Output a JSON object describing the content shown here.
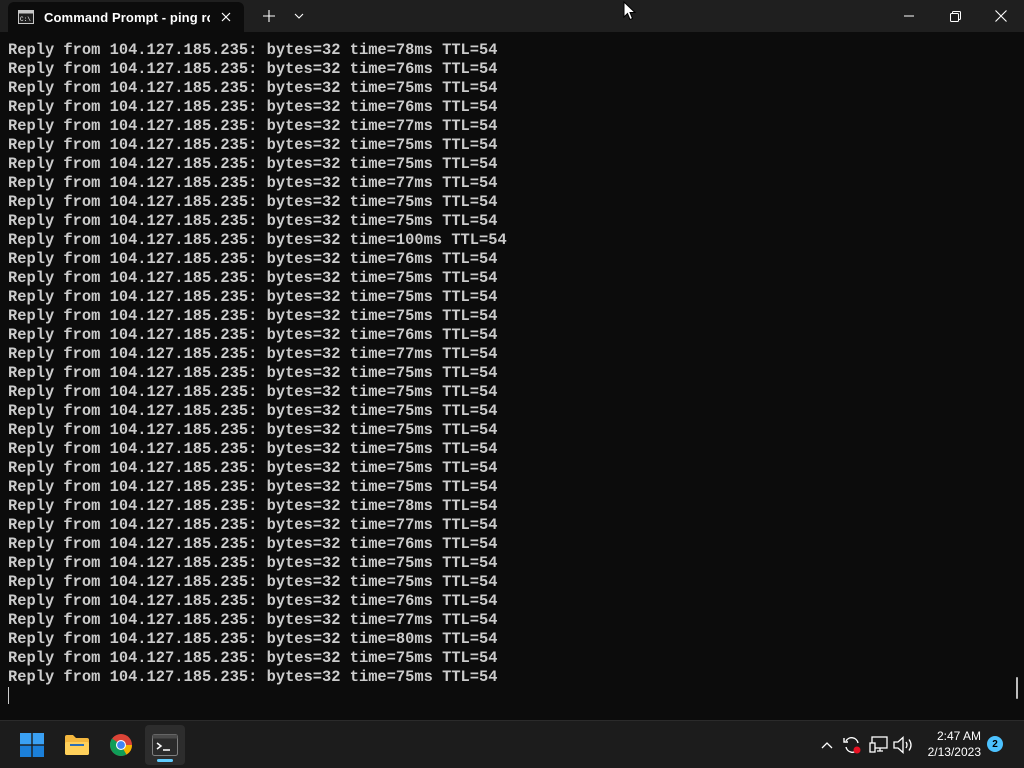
{
  "window": {
    "tab_title": "Command Prompt - ping  roc",
    "tab_icon": "cmd-icon"
  },
  "terminal": {
    "lines": [
      "Reply from 104.127.185.235: bytes=32 time=78ms TTL=54",
      "Reply from 104.127.185.235: bytes=32 time=76ms TTL=54",
      "Reply from 104.127.185.235: bytes=32 time=75ms TTL=54",
      "Reply from 104.127.185.235: bytes=32 time=76ms TTL=54",
      "Reply from 104.127.185.235: bytes=32 time=77ms TTL=54",
      "Reply from 104.127.185.235: bytes=32 time=75ms TTL=54",
      "Reply from 104.127.185.235: bytes=32 time=75ms TTL=54",
      "Reply from 104.127.185.235: bytes=32 time=77ms TTL=54",
      "Reply from 104.127.185.235: bytes=32 time=75ms TTL=54",
      "Reply from 104.127.185.235: bytes=32 time=75ms TTL=54",
      "Reply from 104.127.185.235: bytes=32 time=100ms TTL=54",
      "Reply from 104.127.185.235: bytes=32 time=76ms TTL=54",
      "Reply from 104.127.185.235: bytes=32 time=75ms TTL=54",
      "Reply from 104.127.185.235: bytes=32 time=75ms TTL=54",
      "Reply from 104.127.185.235: bytes=32 time=75ms TTL=54",
      "Reply from 104.127.185.235: bytes=32 time=76ms TTL=54",
      "Reply from 104.127.185.235: bytes=32 time=77ms TTL=54",
      "Reply from 104.127.185.235: bytes=32 time=75ms TTL=54",
      "Reply from 104.127.185.235: bytes=32 time=75ms TTL=54",
      "Reply from 104.127.185.235: bytes=32 time=75ms TTL=54",
      "Reply from 104.127.185.235: bytes=32 time=75ms TTL=54",
      "Reply from 104.127.185.235: bytes=32 time=75ms TTL=54",
      "Reply from 104.127.185.235: bytes=32 time=75ms TTL=54",
      "Reply from 104.127.185.235: bytes=32 time=75ms TTL=54",
      "Reply from 104.127.185.235: bytes=32 time=78ms TTL=54",
      "Reply from 104.127.185.235: bytes=32 time=77ms TTL=54",
      "Reply from 104.127.185.235: bytes=32 time=76ms TTL=54",
      "Reply from 104.127.185.235: bytes=32 time=75ms TTL=54",
      "Reply from 104.127.185.235: bytes=32 time=75ms TTL=54",
      "Reply from 104.127.185.235: bytes=32 time=76ms TTL=54",
      "Reply from 104.127.185.235: bytes=32 time=77ms TTL=54",
      "Reply from 104.127.185.235: bytes=32 time=80ms TTL=54",
      "Reply from 104.127.185.235: bytes=32 time=75ms TTL=54",
      "Reply from 104.127.185.235: bytes=32 time=75ms TTL=54"
    ]
  },
  "taskbar": {
    "apps": [
      {
        "name": "start-button",
        "icon": "windows-logo-icon"
      },
      {
        "name": "file-explorer",
        "icon": "folder-icon"
      },
      {
        "name": "chrome",
        "icon": "chrome-icon"
      },
      {
        "name": "terminal",
        "icon": "terminal-icon",
        "active": true
      }
    ],
    "tray": [
      "chevron-up-icon",
      "sync-icon",
      "network-icon",
      "speaker-icon"
    ],
    "time": "2:47 AM",
    "date": "2/13/2023",
    "notification_count": "2"
  },
  "colors": {
    "terminal_bg": "#0c0c0c",
    "terminal_fg": "#cccccc",
    "titlebar_bg": "#1f1f1f",
    "taskbar_bg": "#1c1c1c",
    "accent": "#60cdff"
  }
}
